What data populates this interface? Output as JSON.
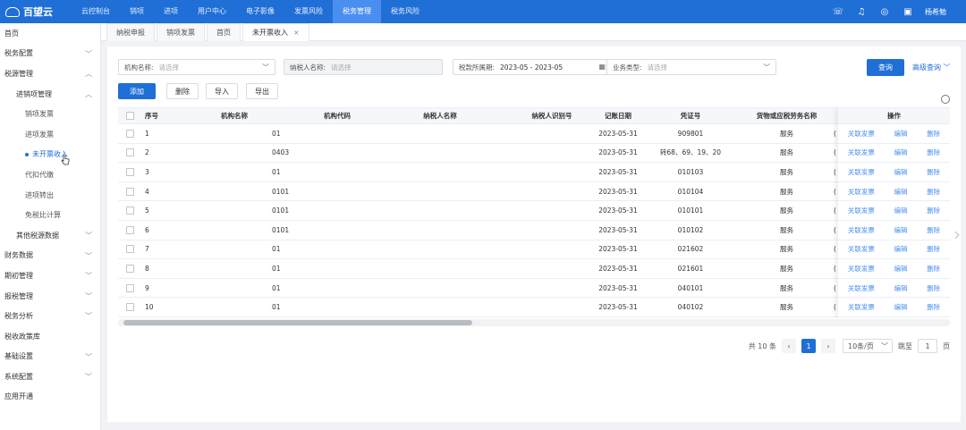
{
  "app": {
    "logo_text": "百望云"
  },
  "nav": {
    "items": [
      "云控制台",
      "销项",
      "进项",
      "用户中心",
      "电子影像",
      "发票风险",
      "税务管理",
      "税务风险"
    ],
    "active_index": 6
  },
  "header_right": {
    "user": "杨希勉"
  },
  "sidebar": {
    "items": [
      {
        "label": "首页",
        "level": 1,
        "chevron": ""
      },
      {
        "label": "税务配置",
        "level": 1,
        "chevron": "﹀"
      },
      {
        "label": "税源管理",
        "level": 1,
        "chevron": "︿"
      },
      {
        "label": "进销项管理",
        "level": 2,
        "chevron": "︿"
      },
      {
        "label": "销项发票",
        "level": 3,
        "chevron": ""
      },
      {
        "label": "进项发票",
        "level": 3,
        "chevron": ""
      },
      {
        "label": "未开票收入",
        "level": 3,
        "chevron": "",
        "active": true
      },
      {
        "label": "代扣代缴",
        "level": 3,
        "chevron": ""
      },
      {
        "label": "进项转出",
        "level": 3,
        "chevron": ""
      },
      {
        "label": "免税比计算",
        "level": 3,
        "chevron": ""
      },
      {
        "label": "其他税源数据",
        "level": 2,
        "chevron": "﹀"
      },
      {
        "label": "财务数据",
        "level": 1,
        "chevron": "﹀"
      },
      {
        "label": "期初管理",
        "level": 1,
        "chevron": "﹀"
      },
      {
        "label": "报税管理",
        "level": 1,
        "chevron": "﹀"
      },
      {
        "label": "税务分析",
        "level": 1,
        "chevron": "﹀"
      },
      {
        "label": "税收政策库",
        "level": 1,
        "chevron": ""
      },
      {
        "label": "基础设置",
        "level": 1,
        "chevron": "﹀"
      },
      {
        "label": "系统配置",
        "level": 1,
        "chevron": "﹀"
      },
      {
        "label": "应用开通",
        "level": 1,
        "chevron": ""
      }
    ]
  },
  "tabs": [
    {
      "label": "纳税申报"
    },
    {
      "label": "销项发票"
    },
    {
      "label": "首页"
    },
    {
      "label": "未开票收入",
      "active": true,
      "close": "×"
    }
  ],
  "filters": {
    "org_label": "机构名称:",
    "org_placeholder": "请选择",
    "taxpayer_label": "纳税人名称:",
    "taxpayer_placeholder": "请选择",
    "period_label": "税款所属期:",
    "period_value": "2023-05 - 2023-05",
    "biz_label": "业务类型:",
    "biz_placeholder": "请选择",
    "query_button": "查询",
    "advanced_query": "高级查询"
  },
  "toolbar": {
    "add": "添加",
    "delete": "删除",
    "import": "导入",
    "export": "导出"
  },
  "table": {
    "columns": [
      "序号",
      "机构名称",
      "机构代码",
      "纳税人名称",
      "纳税人识别号",
      "记账日期",
      "凭证号",
      "货物或应税劳务名称",
      "操作"
    ],
    "rows": [
      {
        "no": "1",
        "org_code": "01",
        "date": "2023-05-31",
        "voucher": "909801",
        "goods": "服务",
        "tail": "("
      },
      {
        "no": "2",
        "org_code": "0403",
        "date": "2023-05-31",
        "voucher": "转68、69、19、20",
        "goods": "服务",
        "tail": "("
      },
      {
        "no": "3",
        "org_code": "01",
        "date": "2023-05-31",
        "voucher": "010103",
        "goods": "服务",
        "tail": "("
      },
      {
        "no": "4",
        "org_code": "0101",
        "date": "2023-05-31",
        "voucher": "010104",
        "goods": "服务",
        "tail": "("
      },
      {
        "no": "5",
        "org_code": "0101",
        "date": "2023-05-31",
        "voucher": "010101",
        "goods": "服务",
        "tail": "("
      },
      {
        "no": "6",
        "org_code": "0101",
        "date": "2023-05-31",
        "voucher": "010102",
        "goods": "服务",
        "tail": "("
      },
      {
        "no": "7",
        "org_code": "01",
        "date": "2023-05-31",
        "voucher": "021602",
        "goods": "服务",
        "tail": "("
      },
      {
        "no": "8",
        "org_code": "01",
        "date": "2023-05-31",
        "voucher": "021601",
        "goods": "服务",
        "tail": "("
      },
      {
        "no": "9",
        "org_code": "01",
        "date": "2023-05-31",
        "voucher": "040101",
        "goods": "服务",
        "tail": "("
      },
      {
        "no": "10",
        "org_code": "01",
        "date": "2023-05-31",
        "voucher": "040102",
        "goods": "服务",
        "tail": "("
      }
    ],
    "row_actions": {
      "link": "关联发票",
      "edit": "编辑",
      "delete": "删除"
    }
  },
  "pager": {
    "total": "共 10 条",
    "current": "1",
    "page_size": "10条/页",
    "goto_label": "跳至",
    "goto_value": "1",
    "page_unit": "页"
  },
  "colors": {
    "primary": "#1f6fd6",
    "nav_active": "#4a8ff0",
    "link": "#4a8ff0"
  }
}
